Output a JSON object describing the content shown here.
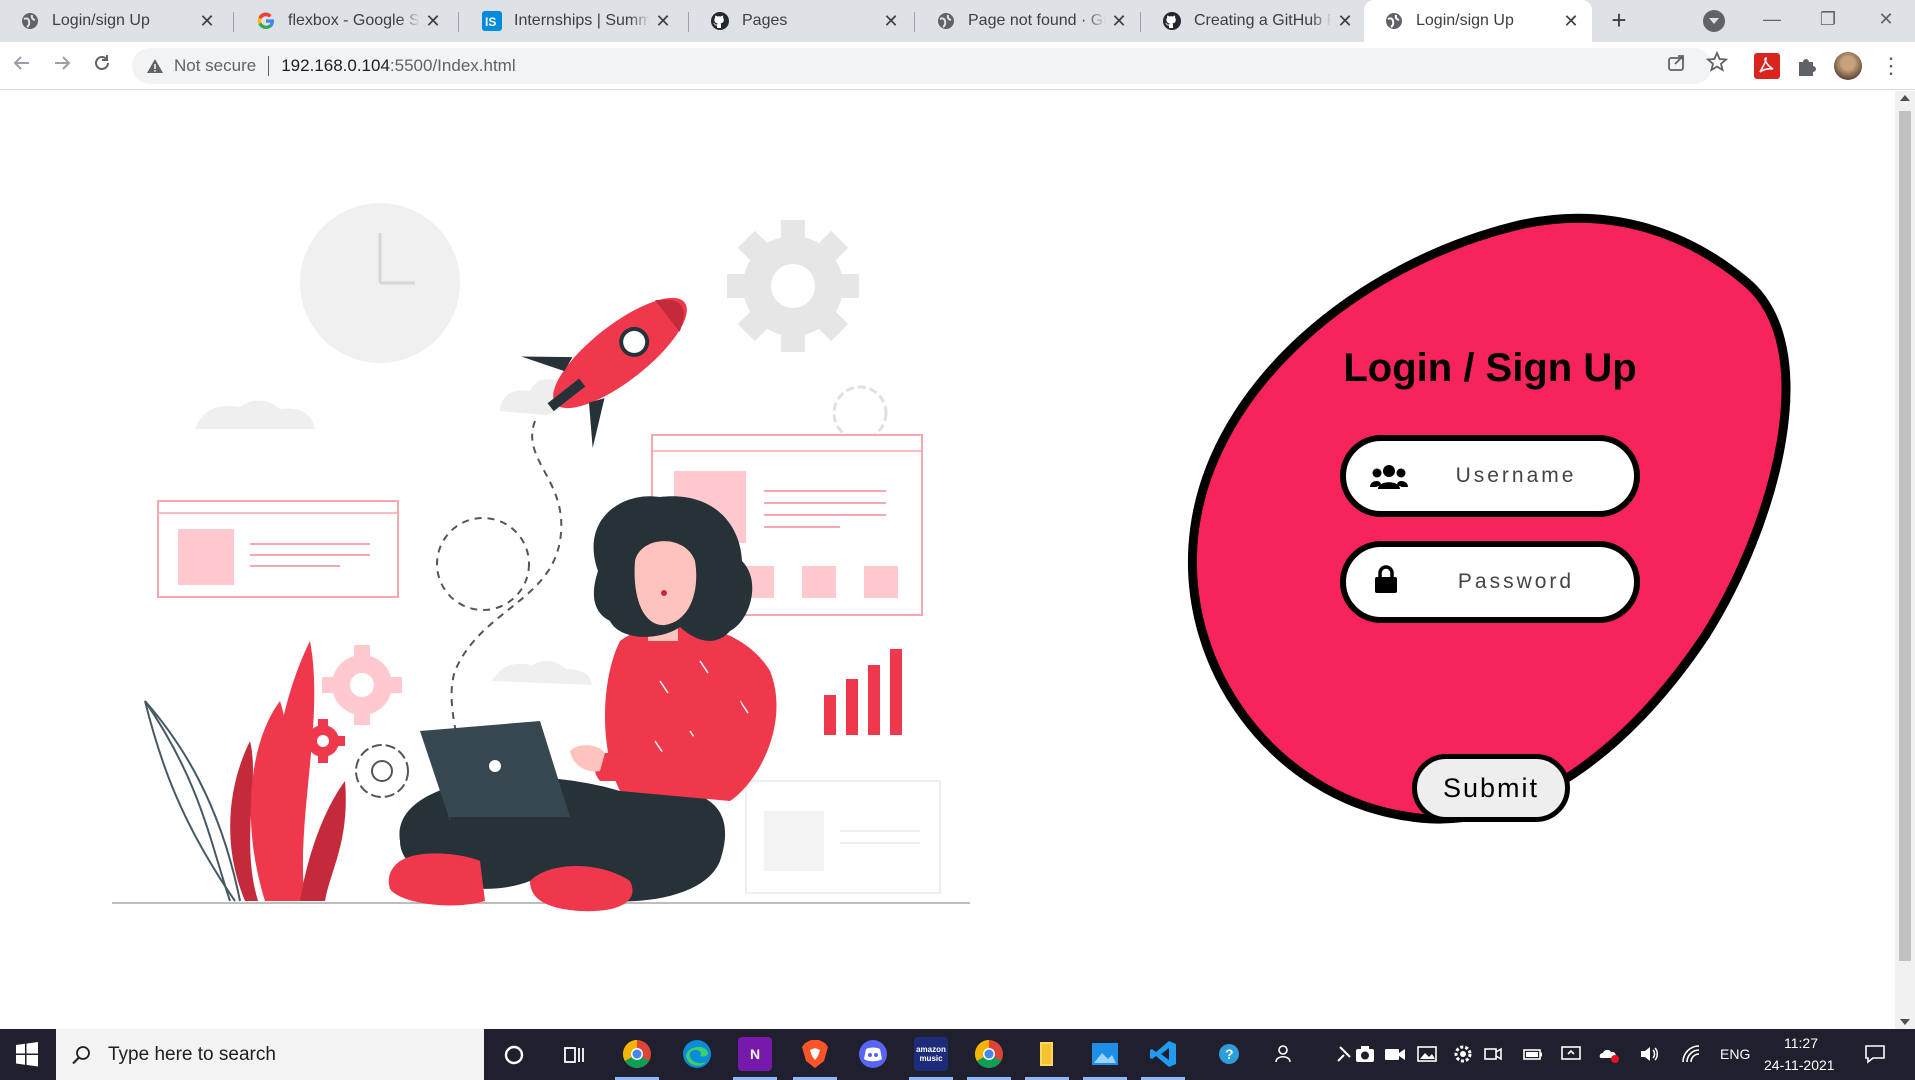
{
  "tabs": [
    {
      "title": "Login/sign Up",
      "icon": "globe-icon",
      "active": false
    },
    {
      "title": "flexbox - Google Sear",
      "icon": "google-icon",
      "active": false
    },
    {
      "title": "Internships | Summer",
      "icon": "internshala-icon",
      "active": false
    },
    {
      "title": "Pages",
      "icon": "github-icon",
      "active": false
    },
    {
      "title": "Page not found · GitH",
      "icon": "globe-icon",
      "active": false
    },
    {
      "title": "Creating a GitHub Pag",
      "icon": "github-icon",
      "active": false
    },
    {
      "title": "Login/sign Up",
      "icon": "globe-icon",
      "active": true
    }
  ],
  "tab_close_glyph": "✕",
  "new_tab_glyph": "+",
  "window": {
    "minimize": "—",
    "restore": "❐",
    "close": "✕"
  },
  "address_bar": {
    "security_text": "Not secure",
    "url_host": "192.168.0.104",
    "url_path": ":5500/Index.html"
  },
  "form": {
    "title": "Login / Sign Up",
    "username_placeholder": "Username",
    "password_placeholder": "Password",
    "submit_label": "Submit",
    "blob_color": "#f6245a",
    "border_color": "#000000"
  },
  "illustration": {
    "accent": "#f0384c",
    "accent_light": "#ffc9cf",
    "dark": "#263238",
    "gray": "#ebebeb"
  },
  "taskbar": {
    "search_placeholder": "Type here to search",
    "language": "ENG",
    "time": "11:27",
    "date": "24-11-2021",
    "apps": [
      "chrome-icon",
      "edge-icon",
      "onenote-icon",
      "brave-icon",
      "discord-icon",
      "amazon-music-icon",
      "chrome-icon",
      "file-explorer-icon",
      "photos-icon",
      "vscode-icon"
    ],
    "amazon_music_label": "amazon music"
  }
}
